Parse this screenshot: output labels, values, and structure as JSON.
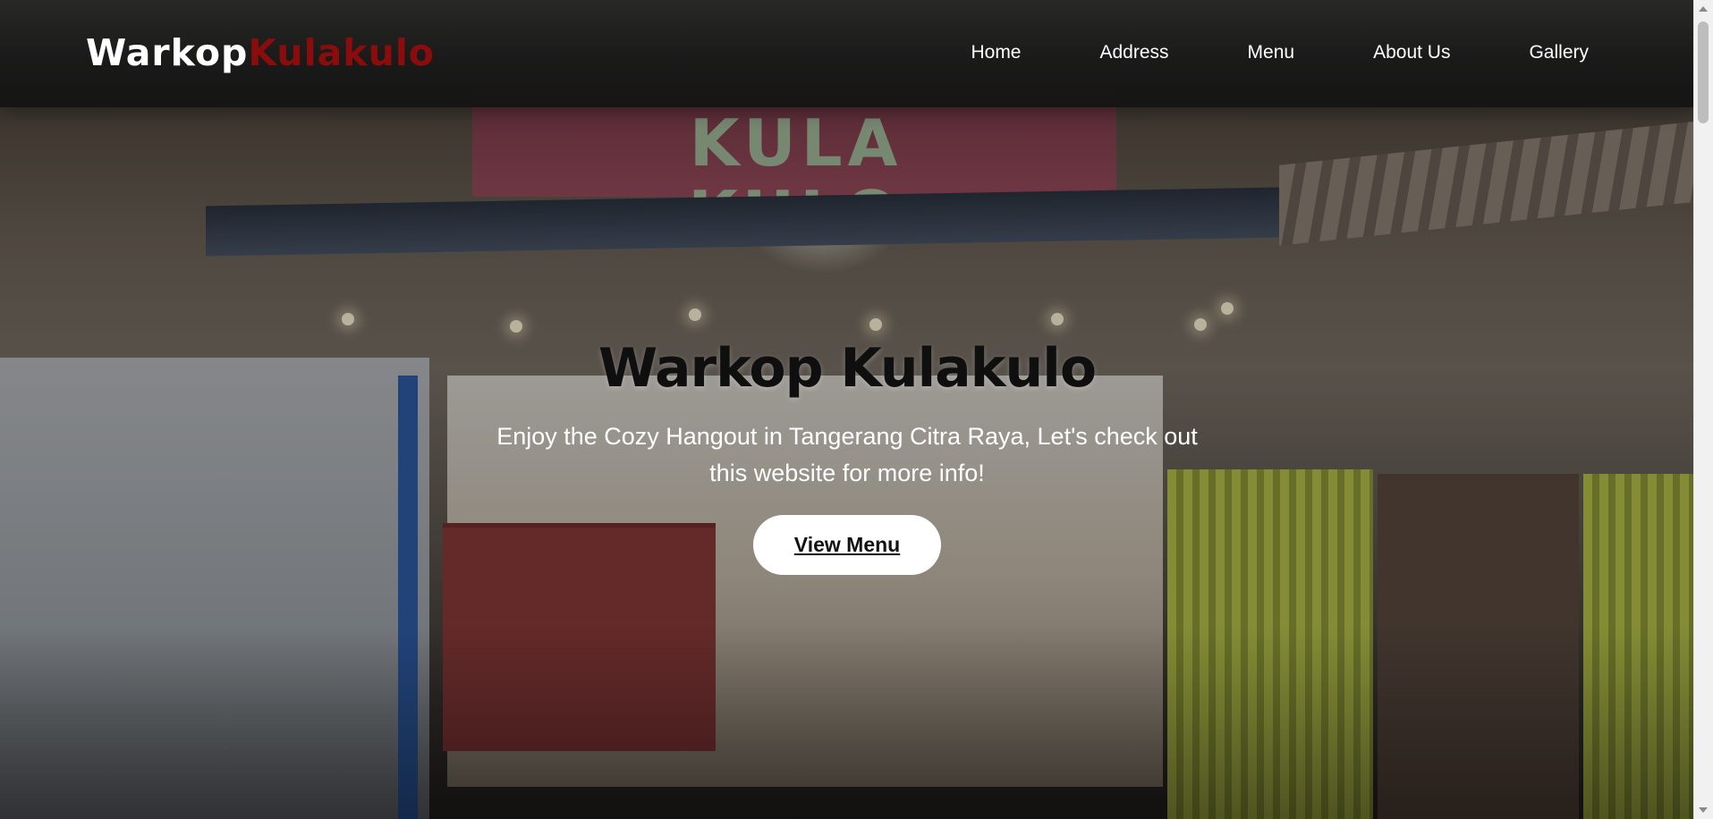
{
  "brand": {
    "part1": "Warkop",
    "part2": "Kulakulo"
  },
  "nav": {
    "items": [
      {
        "label": "Home"
      },
      {
        "label": "Address"
      },
      {
        "label": "Menu"
      },
      {
        "label": "About Us"
      },
      {
        "label": "Gallery"
      }
    ]
  },
  "hero": {
    "title": "Warkop Kulakulo",
    "subtitle": "Enjoy the Cozy Hangout in Tangerang Citra Raya, Let's check out this website for more info!",
    "cta_label": "View Menu",
    "background_image": "storefront-night-photo",
    "sign_text": "KULA KULO"
  },
  "colors": {
    "brand_accent": "#8a0c0c",
    "nav_text": "#ffffff",
    "title_text": "#0f0f0f",
    "cta_bg": "#ffffff"
  }
}
